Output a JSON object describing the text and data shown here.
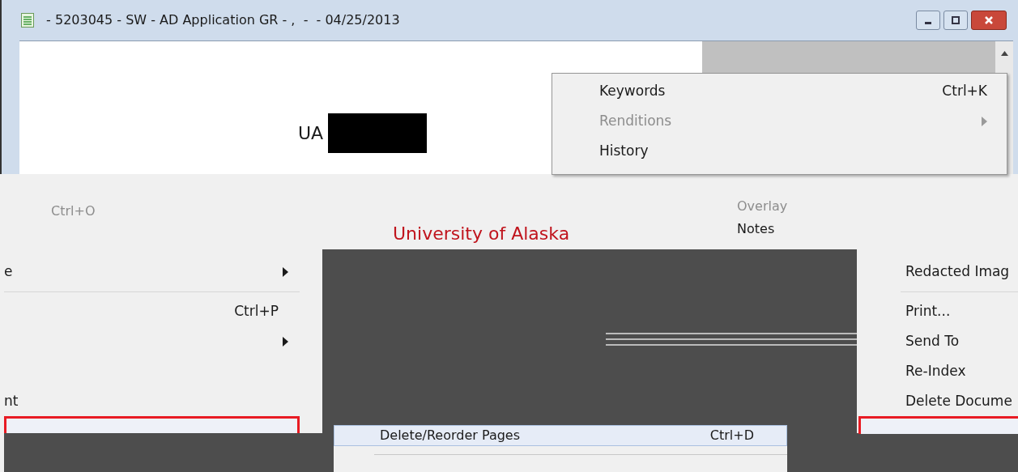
{
  "window": {
    "title": " - 5203045 - SW - AD Application GR - ,  -  - 04/25/2013"
  },
  "document": {
    "text": "UA",
    "heading": "University of Alaska"
  },
  "top_menu": {
    "items": [
      {
        "label": "Keywords",
        "shortcut": "Ctrl+K",
        "disabled": false,
        "submenu": false
      },
      {
        "label": "Renditions",
        "disabled": true,
        "submenu": true
      },
      {
        "label": "History",
        "disabled": false,
        "submenu": false
      }
    ]
  },
  "left_menu": {
    "shortcut_fragment": "Ctrl+O",
    "items": [
      {
        "kind": "item",
        "label": "e",
        "submenu": true,
        "highlighted": false
      },
      {
        "kind": "separator"
      },
      {
        "kind": "item",
        "shortcut": "Ctrl+P",
        "submenu": false,
        "highlighted": false
      },
      {
        "kind": "item",
        "submenu": true,
        "highlighted": false
      },
      {
        "kind": "spacer"
      },
      {
        "kind": "item",
        "label": "nt",
        "submenu": false,
        "highlighted": false
      },
      {
        "kind": "item",
        "submenu": false,
        "highlighted": true
      }
    ]
  },
  "middle_menu": {
    "items": [
      {
        "label": "Overlay",
        "disabled": true
      },
      {
        "label": "Notes",
        "disabled": false
      }
    ]
  },
  "bottom_menu": {
    "items": [
      {
        "label": "Delete/Reorder Pages",
        "shortcut": "Ctrl+D",
        "highlighted": true
      }
    ]
  },
  "right_menu": {
    "items": [
      {
        "kind": "item",
        "label": "Redacted Imag",
        "highlighted": false
      },
      {
        "kind": "separator"
      },
      {
        "kind": "item",
        "label": "Print...",
        "highlighted": false
      },
      {
        "kind": "item",
        "label": "Send To",
        "highlighted": false
      },
      {
        "kind": "item",
        "label": "Re-Index",
        "highlighted": false
      },
      {
        "kind": "item",
        "label": "Delete Docume",
        "highlighted": false
      },
      {
        "kind": "item",
        "highlighted": true
      }
    ]
  }
}
